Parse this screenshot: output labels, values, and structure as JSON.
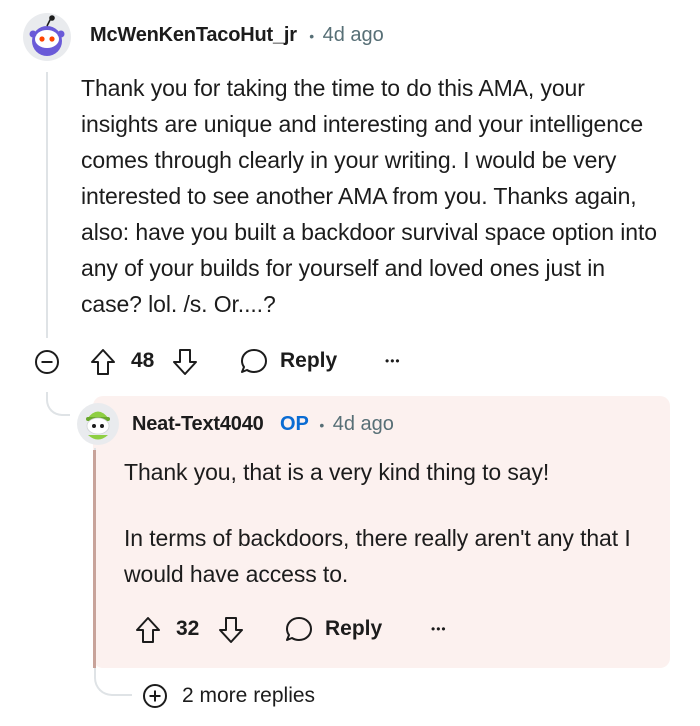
{
  "comment": {
    "username": "McWenKenTacoHut_jr",
    "separator": "•",
    "time": "4d ago",
    "body": "Thank you for taking the time to do this AMA, your insights are unique and interesting and your intelligence comes through clearly in your writing. I would be very interested to see another AMA from you. Thanks again, also: have you built a backdoor survival space option into any of your builds for yourself and loved ones just in case? lol. /s. Or....?",
    "votes": "48",
    "reply_label": "Reply",
    "more_label": "•••"
  },
  "reply": {
    "username": "Neat-Text4040",
    "op_badge": "OP",
    "separator": "•",
    "time": "4d ago",
    "paragraph1": "Thank you, that is a very kind thing to say!",
    "paragraph2": "In terms of backdoors, there really aren't any that I would have access to.",
    "votes": "32",
    "reply_label": "Reply",
    "more_label": "•••",
    "highlight_color": "#fcf1ef"
  },
  "more_replies": {
    "label": "2 more replies"
  },
  "icons": [
    "snoo-avatar-icon",
    "collapse-icon",
    "upvote-icon",
    "downvote-icon",
    "reply-bubble-icon",
    "more-icon",
    "expand-plus-icon"
  ]
}
